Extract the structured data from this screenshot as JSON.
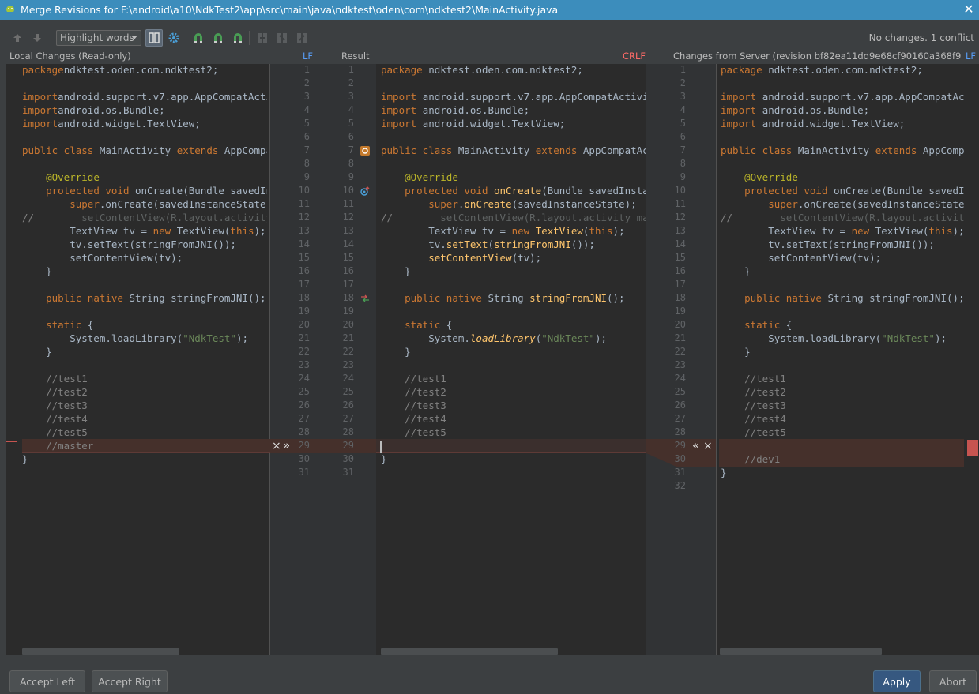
{
  "window": {
    "title": "Merge Revisions for F:\\android\\a10\\NdkTest2\\app\\src\\main\\java\\ndktest\\oden\\com\\ndktest2\\MainActivity.java"
  },
  "toolbar": {
    "highlight_mode": "Highlight words",
    "status": "No changes. 1 conflict"
  },
  "headers": {
    "left_title": "Local Changes (Read-only)",
    "left_line_sep": "LF",
    "center_title": "Result",
    "center_line_sep": "CRLF",
    "right_title": "Changes from Server (revision bf82ea11dd9e68cf90160a368f953...",
    "right_line_sep": "LF"
  },
  "left_numbers": [
    "1",
    "2",
    "3",
    "4",
    "5",
    "6",
    "7",
    "8",
    "9",
    "10",
    "11",
    "12",
    "13",
    "14",
    "15",
    "16",
    "17",
    "18",
    "19",
    "20",
    "21",
    "22",
    "23",
    "24",
    "25",
    "26",
    "27",
    "28",
    "29",
    "30",
    "31"
  ],
  "center_numbers": [
    "1",
    "2",
    "3",
    "4",
    "5",
    "6",
    "7",
    "8",
    "9",
    "10",
    "11",
    "12",
    "13",
    "14",
    "15",
    "16",
    "17",
    "18",
    "19",
    "20",
    "21",
    "22",
    "23",
    "24",
    "25",
    "26",
    "27",
    "28",
    "29",
    "30",
    "31"
  ],
  "right_numbers": [
    "1",
    "2",
    "3",
    "4",
    "5",
    "6",
    "7",
    "8",
    "9",
    "10",
    "11",
    "12",
    "13",
    "14",
    "15",
    "16",
    "17",
    "18",
    "19",
    "20",
    "21",
    "22",
    "23",
    "24",
    "25",
    "26",
    "27",
    "28",
    "29",
    "30",
    "31",
    "32"
  ],
  "left_code": [
    [
      [
        "kw",
        "package"
      ],
      [
        "",
        "ndktest.oden.com.ndktest2;"
      ]
    ],
    [],
    [
      [
        "kw",
        "import"
      ],
      [
        "",
        "android.support.v7.app.AppCompatActivity;"
      ]
    ],
    [
      [
        "kw",
        "import"
      ],
      [
        "",
        "android.os.Bundle;"
      ]
    ],
    [
      [
        "kw",
        "import"
      ],
      [
        "",
        "android.widget.TextView;"
      ]
    ],
    [],
    [
      [
        "kw",
        "public class "
      ],
      [
        "",
        "MainActivity "
      ],
      [
        "kw",
        "extends "
      ],
      [
        "",
        "AppCompatActivity {"
      ]
    ],
    [],
    [
      [
        "",
        "    "
      ],
      [
        "ann",
        "@Override"
      ]
    ],
    [
      [
        "",
        "    "
      ],
      [
        "kw",
        "protected void "
      ],
      [
        "",
        "onCreate(Bundle savedInstanceState) {"
      ]
    ],
    [
      [
        "",
        "        "
      ],
      [
        "kw",
        "super"
      ],
      [
        "",
        ".onCreate(savedInstanceState);"
      ]
    ],
    [
      [
        "cm",
        "//"
      ],
      [
        "",
        "        "
      ],
      [
        "grey",
        "setContentView(R.layout.activity_main);"
      ]
    ],
    [
      [
        "",
        "        TextView tv = "
      ],
      [
        "kw",
        "new "
      ],
      [
        "",
        "TextView("
      ],
      [
        "kw",
        "this"
      ],
      [
        "",
        ");"
      ]
    ],
    [
      [
        "",
        "        tv.setText(stringFromJNI());"
      ]
    ],
    [
      [
        "",
        "        setContentView(tv);"
      ]
    ],
    [
      [
        "",
        "    }"
      ]
    ],
    [],
    [
      [
        "",
        "    "
      ],
      [
        "kw",
        "public native "
      ],
      [
        "",
        "String stringFromJNI();"
      ]
    ],
    [],
    [
      [
        "",
        "    "
      ],
      [
        "kw",
        "static "
      ],
      [
        "",
        "{"
      ]
    ],
    [
      [
        "",
        "        System.loadLibrary("
      ],
      [
        "str",
        "\"NdkTest\""
      ],
      [
        "",
        ");"
      ]
    ],
    [
      [
        "",
        "    }"
      ]
    ],
    [],
    [
      [
        "",
        "    "
      ],
      [
        "cm",
        "//test1"
      ]
    ],
    [
      [
        "",
        "    "
      ],
      [
        "cm",
        "//test2"
      ]
    ],
    [
      [
        "",
        "    "
      ],
      [
        "cm",
        "//test3"
      ]
    ],
    [
      [
        "",
        "    "
      ],
      [
        "cm",
        "//test4"
      ]
    ],
    [
      [
        "",
        "    "
      ],
      [
        "cm",
        "//test5"
      ]
    ],
    [
      [
        "",
        "    "
      ],
      [
        "cm",
        "//master"
      ]
    ],
    [
      [
        "",
        "}"
      ]
    ],
    []
  ],
  "center_code": [
    [
      [
        "kw",
        "package "
      ],
      [
        "",
        "ndktest.oden.com.ndktest2;"
      ]
    ],
    [],
    [
      [
        "kw",
        "import "
      ],
      [
        "",
        "android.support.v7.app.AppCompatActivity;"
      ]
    ],
    [
      [
        "kw",
        "import "
      ],
      [
        "",
        "android.os.Bundle;"
      ]
    ],
    [
      [
        "kw",
        "import "
      ],
      [
        "",
        "android.widget.TextView;"
      ]
    ],
    [],
    [
      [
        "kw",
        "public class "
      ],
      [
        "",
        "MainActivity "
      ],
      [
        "kw",
        "extends "
      ],
      [
        "",
        "AppCompatActivity {"
      ]
    ],
    [],
    [
      [
        "",
        "    "
      ],
      [
        "ann",
        "@Override"
      ]
    ],
    [
      [
        "",
        "    "
      ],
      [
        "kw",
        "protected void "
      ],
      [
        "fn",
        "onCreate"
      ],
      [
        "",
        "(Bundle savedInstanceState) {"
      ]
    ],
    [
      [
        "",
        "        "
      ],
      [
        "kw",
        "super"
      ],
      [
        "",
        "."
      ],
      [
        "fn",
        "onCreate"
      ],
      [
        "",
        "(savedInstanceState);"
      ]
    ],
    [
      [
        "cm",
        "//"
      ],
      [
        "",
        "        "
      ],
      [
        "grey",
        "setContentView(R.layout.activity_main);"
      ]
    ],
    [
      [
        "",
        "        TextView tv = "
      ],
      [
        "kw",
        "new "
      ],
      [
        "fn",
        "TextView"
      ],
      [
        "",
        "("
      ],
      [
        "kw",
        "this"
      ],
      [
        "",
        ");"
      ]
    ],
    [
      [
        "",
        "        tv."
      ],
      [
        "fn",
        "setText"
      ],
      [
        "",
        "("
      ],
      [
        "fn",
        "stringFromJNI"
      ],
      [
        "",
        "());"
      ]
    ],
    [
      [
        "",
        "        "
      ],
      [
        "fn",
        "setContentView"
      ],
      [
        "",
        "(tv);"
      ]
    ],
    [
      [
        "",
        "    }"
      ]
    ],
    [],
    [
      [
        "",
        "    "
      ],
      [
        "kw",
        "public native "
      ],
      [
        "",
        "String "
      ],
      [
        "fn",
        "stringFromJNI"
      ],
      [
        "",
        "();"
      ]
    ],
    [],
    [
      [
        "",
        "    "
      ],
      [
        "kw",
        "static "
      ],
      [
        "",
        "{"
      ]
    ],
    [
      [
        "",
        "        System."
      ],
      [
        "sfn",
        "loadLibrary"
      ],
      [
        "",
        "("
      ],
      [
        "str",
        "\"NdkTest\""
      ],
      [
        "",
        ");"
      ]
    ],
    [
      [
        "",
        "    }"
      ]
    ],
    [],
    [
      [
        "",
        "    "
      ],
      [
        "cm",
        "//test1"
      ]
    ],
    [
      [
        "",
        "    "
      ],
      [
        "cm",
        "//test2"
      ]
    ],
    [
      [
        "",
        "    "
      ],
      [
        "cm",
        "//test3"
      ]
    ],
    [
      [
        "",
        "    "
      ],
      [
        "cm",
        "//test4"
      ]
    ],
    [
      [
        "",
        "    "
      ],
      [
        "cm",
        "//test5"
      ]
    ],
    [],
    [
      [
        "",
        "}"
      ]
    ],
    []
  ],
  "right_code": [
    [
      [
        "kw",
        "package "
      ],
      [
        "",
        "ndktest.oden.com.ndktest2;"
      ]
    ],
    [],
    [
      [
        "kw",
        "import "
      ],
      [
        "",
        "android.support.v7.app.AppCompatActivity;"
      ]
    ],
    [
      [
        "kw",
        "import "
      ],
      [
        "",
        "android.os.Bundle;"
      ]
    ],
    [
      [
        "kw",
        "import "
      ],
      [
        "",
        "android.widget.TextView;"
      ]
    ],
    [],
    [
      [
        "kw",
        "public class "
      ],
      [
        "",
        "MainActivity "
      ],
      [
        "kw",
        "extends "
      ],
      [
        "",
        "AppCompatActivity {"
      ]
    ],
    [],
    [
      [
        "",
        "    "
      ],
      [
        "ann",
        "@Override"
      ]
    ],
    [
      [
        "",
        "    "
      ],
      [
        "kw",
        "protected void "
      ],
      [
        "",
        "onCreate(Bundle savedInstanceState) {"
      ]
    ],
    [
      [
        "",
        "        "
      ],
      [
        "kw",
        "super"
      ],
      [
        "",
        ".onCreate(savedInstanceState);"
      ]
    ],
    [
      [
        "cm",
        "//"
      ],
      [
        "",
        "        "
      ],
      [
        "grey",
        "setContentView(R.layout.activity_main);"
      ]
    ],
    [
      [
        "",
        "        TextView tv = "
      ],
      [
        "kw",
        "new "
      ],
      [
        "",
        "TextView("
      ],
      [
        "kw",
        "this"
      ],
      [
        "",
        ");"
      ]
    ],
    [
      [
        "",
        "        tv.setText(stringFromJNI());"
      ]
    ],
    [
      [
        "",
        "        setContentView(tv);"
      ]
    ],
    [
      [
        "",
        "    }"
      ]
    ],
    [],
    [
      [
        "",
        "    "
      ],
      [
        "kw",
        "public native "
      ],
      [
        "",
        "String stringFromJNI();"
      ]
    ],
    [],
    [
      [
        "",
        "    "
      ],
      [
        "kw",
        "static "
      ],
      [
        "",
        "{"
      ]
    ],
    [
      [
        "",
        "        System.loadLibrary("
      ],
      [
        "str",
        "\"NdkTest\""
      ],
      [
        "",
        ");"
      ]
    ],
    [
      [
        "",
        "    }"
      ]
    ],
    [],
    [
      [
        "",
        "    "
      ],
      [
        "cm",
        "//test1"
      ]
    ],
    [
      [
        "",
        "    "
      ],
      [
        "cm",
        "//test2"
      ]
    ],
    [
      [
        "",
        "    "
      ],
      [
        "cm",
        "//test3"
      ]
    ],
    [
      [
        "",
        "    "
      ],
      [
        "cm",
        "//test4"
      ]
    ],
    [
      [
        "",
        "    "
      ],
      [
        "cm",
        "//test5"
      ]
    ],
    [],
    [
      [
        "",
        "    "
      ],
      [
        "cm",
        "//dev1"
      ]
    ],
    [
      [
        "",
        "}"
      ]
    ],
    []
  ],
  "conflict_controls": {
    "left_reject": "×",
    "left_apply": "»",
    "right_apply": "«",
    "right_reject": "×"
  },
  "buttons": {
    "accept_left": "Accept Left",
    "accept_right": "Accept Right",
    "apply": "Apply",
    "abort": "Abort"
  }
}
